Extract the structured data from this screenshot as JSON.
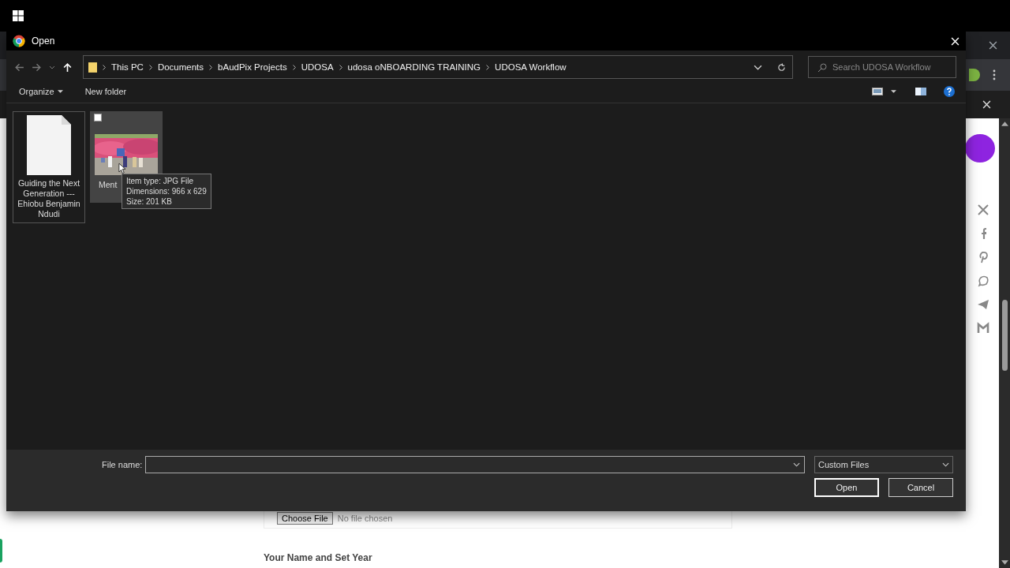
{
  "window": {
    "title": "Open"
  },
  "breadcrumb": [
    "This PC",
    "Documents",
    "bAudPix Projects",
    "UDOSA",
    "udosa oNBOARDING TRAINING",
    "UDOSA Workflow"
  ],
  "search": {
    "placeholder": "Search UDOSA Workflow"
  },
  "toolbar": {
    "organize": "Organize",
    "new_folder": "New folder"
  },
  "files": [
    {
      "kind": "document",
      "label": "Guiding the Next Generation --- Ehiobu Benjamin Ndudi",
      "hovered": false,
      "focused": true
    },
    {
      "kind": "picture",
      "label": "Ment",
      "hovered": true,
      "checked": false,
      "focused": false
    }
  ],
  "tooltip": [
    "Item type: JPG File",
    "Dimensions: 966 x 629",
    "Size: 201 KB"
  ],
  "file_name_label": "File name:",
  "file_type": "Custom Files",
  "buttons": [
    "Open",
    "Cancel"
  ],
  "page": {
    "choose_file": "Choose File",
    "no_file": "No file chosen",
    "field_label": "Your Name and Set Year"
  }
}
